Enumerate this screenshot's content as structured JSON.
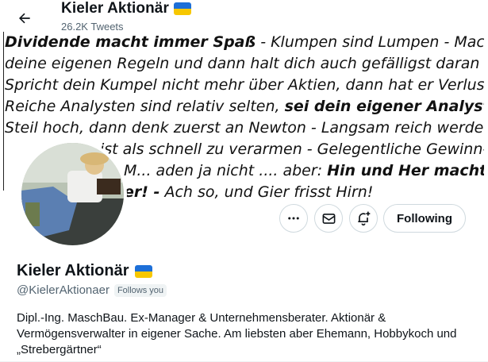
{
  "header": {
    "title": "Kieler Aktionär",
    "tweet_count": "26.2K Tweets",
    "back_icon": "arrow-left-icon"
  },
  "banner": {
    "line1_bold": "Dividende macht immer Spaß",
    "line1_rest": " - Klumpen sind Lumpen - Mach",
    "line2": "deine eigenen Regeln und dann halt dich auch gefälligst daran -",
    "line3": "Spricht dein Kumpel nicht mehr über Aktien, dann hat er Verluste -",
    "line4_start": "Reiche Analysten sind relativ selten, ",
    "line4_bold": "sei dein eigener Analyst",
    "line4_end": " -",
    "line5": "Steil hoch, dann denk zuerst an Newton - Langsam reich werden",
    "line6": "ist als schnell zu verarmen - Gelegentliche Gewinn-",
    "line7_start": "M... aden ja nicht .... aber: ",
    "line7_bold": "Hin und Her macht Taschen",
    "line8_bold": "er! -",
    "line8_rest": " Ach so, und Gier frisst Hirn!"
  },
  "actions": {
    "more_icon": "more-icon",
    "message_icon": "envelope-icon",
    "notify_icon": "bell-plus-icon",
    "following_label": "Following"
  },
  "profile": {
    "name": "Kieler Aktionär",
    "handle": "@KielerAktionaer",
    "follows_you": "Follows you",
    "bio": "Dipl.-Ing. MaschBau. Ex-Manager & Unternehmensberater. Aktionär & Vermögensverwalter in eigener Sache. Am liebsten aber Ehemann, Hobbykoch und „Strebergärtner“"
  },
  "colors": {
    "flag_blue": "#1d6fd8",
    "flag_yellow": "#f7c700",
    "secondary_text": "#536471",
    "border": "#cfd9de"
  }
}
